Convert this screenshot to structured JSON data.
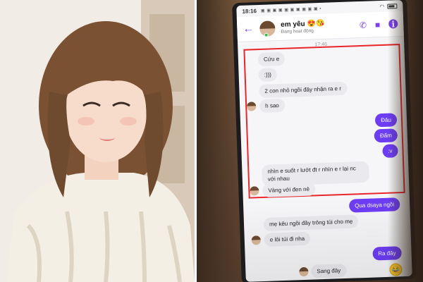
{
  "status_bar": {
    "time": "18:16",
    "icons": "▣ ▣ ▣ ▣ ▣ ▣ ▣ ▣ ▣ ▣ •",
    "battery_icon": "battery-icon",
    "wifi_icon": "wifi-icon"
  },
  "chat_header": {
    "contact_name": "em yêu 😍😘",
    "contact_status": "Đang hoạt động",
    "back_icon": "back-arrow-icon",
    "call_icon": "phone-icon",
    "video_icon": "video-camera-icon",
    "info_icon": "info-icon",
    "info_glyph": "i"
  },
  "timestamp": "17:46",
  "messages": [
    {
      "dir": "in",
      "text": "Cứu e"
    },
    {
      "dir": "in",
      "text": ":)))"
    },
    {
      "dir": "in",
      "text": "2 con nhỏ ngồi đây nhận ra e r"
    },
    {
      "dir": "in",
      "text": "h sao"
    },
    {
      "dir": "out",
      "text": "Đâu"
    },
    {
      "dir": "out",
      "text": "Đấm"
    },
    {
      "dir": "out",
      "text": ":v"
    },
    {
      "dir": "in",
      "text": "nhìn e suốt r lướt đt r nhìn e r lại nc với nhau"
    },
    {
      "dir": "in",
      "text": "Vàng với đen nè"
    },
    {
      "dir": "out",
      "text": "Qua dsaya ngồi"
    },
    {
      "dir": "in",
      "text": "mẹ kêu ngồi đây trông túi cho mẹ"
    },
    {
      "dir": "in",
      "text": "e lôi túi đi nha"
    },
    {
      "dir": "out",
      "text": "Ra đây"
    },
    {
      "dir": "in",
      "text": "Sang đây"
    }
  ],
  "emoji_button": {
    "glyph": "😂",
    "icon": "laughing-emoji-icon"
  },
  "colors": {
    "messenger_purple": "#6d3df5",
    "highlight_red": "#e8262b",
    "incoming_bubble": "#e9e9ee"
  }
}
